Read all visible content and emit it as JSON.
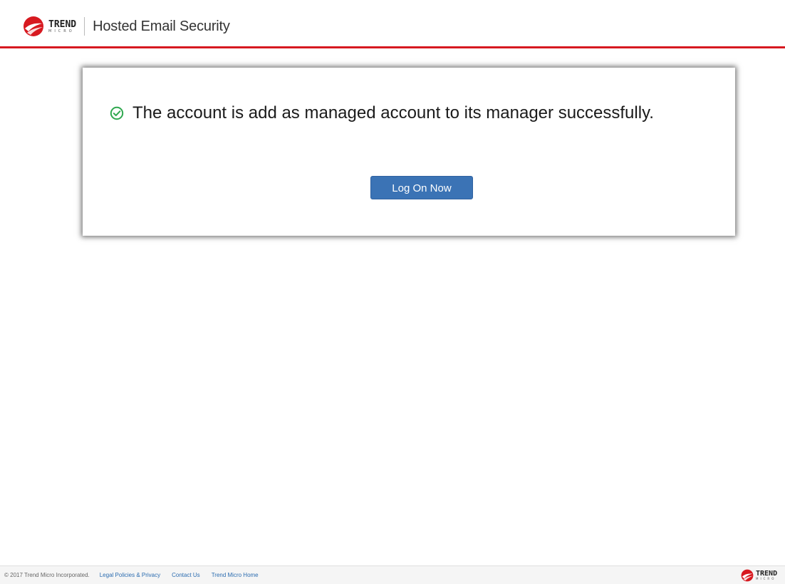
{
  "header": {
    "brand_trend": "TREND",
    "brand_micro": "MICRO",
    "product_name": "Hosted Email Security",
    "logo_icon": "trend-micro-ball-icon"
  },
  "message": {
    "icon": "check-circle-icon",
    "text": "The account is add as managed account to its manager successfully."
  },
  "actions": {
    "logon_label": "Log On Now"
  },
  "footer": {
    "copyright": "© 2017 Trend Micro Incorporated.",
    "links": [
      {
        "label": "Legal Policies & Privacy"
      },
      {
        "label": "Contact Us"
      },
      {
        "label": "Trend Micro Home"
      }
    ],
    "brand_trend": "TREND",
    "brand_micro": "MICRO"
  },
  "colors": {
    "accent_red": "#d71920",
    "button_blue": "#3b73b5",
    "success_green": "#2fa84f",
    "link_blue": "#2b6cb0"
  }
}
